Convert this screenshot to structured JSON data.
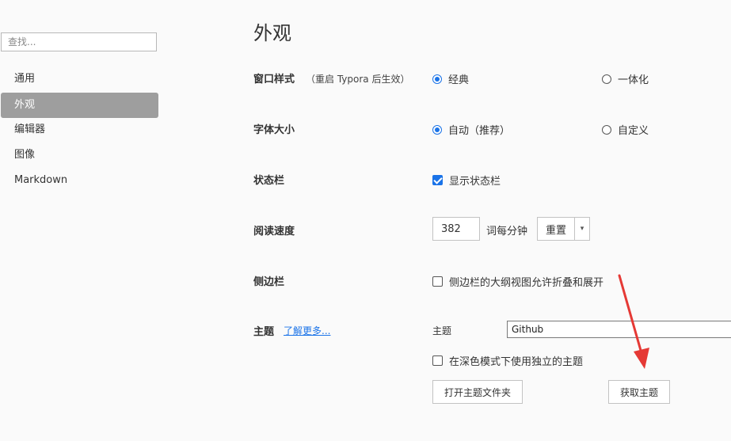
{
  "sidebar": {
    "search_placeholder": "查找...",
    "items": [
      {
        "label": "通用"
      },
      {
        "label": "外观"
      },
      {
        "label": "编辑器"
      },
      {
        "label": "图像"
      },
      {
        "label": "Markdown"
      }
    ],
    "active_index": 1
  },
  "main": {
    "title": "外观",
    "window_style": {
      "label": "窗口样式",
      "note": "（重启 Typora 后生效）",
      "options": [
        "经典",
        "一体化"
      ],
      "selected": "经典"
    },
    "font_size": {
      "label": "字体大小",
      "options": [
        "自动（推荐）",
        "自定义"
      ],
      "selected": "自动（推荐）"
    },
    "status_bar": {
      "label": "状态栏",
      "checkbox_label": "显示状态栏",
      "checked": true
    },
    "reading_speed": {
      "label": "阅读速度",
      "value": "382",
      "unit": "词每分钟",
      "reset_label": "重置",
      "caret": "▾"
    },
    "sidebar_setting": {
      "label": "侧边栏",
      "checkbox_label": "侧边栏的大纲视图允许折叠和展开",
      "checked": false
    },
    "theme": {
      "label": "主题",
      "learn_more": "了解更多...",
      "field_label": "主题",
      "selected": "Github",
      "dark_mode_label": "在深色模式下使用独立的主题",
      "dark_mode_checked": false,
      "open_folder_label": "打开主题文件夹",
      "get_themes_label": "获取主题"
    }
  },
  "colors": {
    "accent": "#1a73e8",
    "active_nav": "#9e9e9e",
    "annotation_arrow": "#e53935"
  }
}
